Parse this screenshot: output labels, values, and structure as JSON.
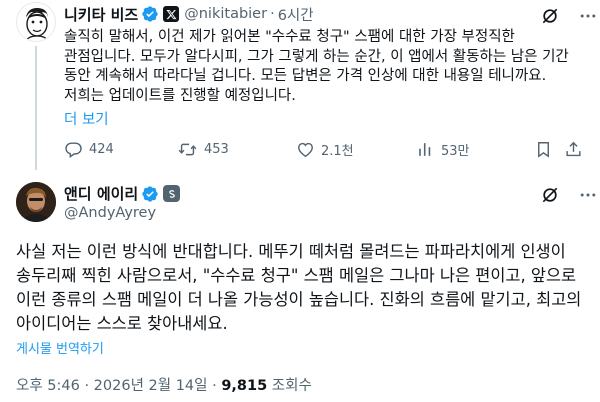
{
  "parent_tweet": {
    "author_name": "니키타 비즈",
    "handle": "@nikitabier",
    "separator": "·",
    "time": "6시간",
    "body": "솔직히 말해서, 이건 제가 읽어본 \"수수료 청구\" 스팸에 대한 가장 부정직한 관점입니다. 모두가 알다시피, 그가 그렇게 하는 순간, 이 앱에서 활동하는 남은 기간 동안 계속해서 따라다닐 겁니다. 모든 답변은 가격 인상에 대한 내용일 테니까요. 저희는 업데이트를 진행할 예정입니다.",
    "show_more": "더 보기",
    "actions": {
      "replies": "424",
      "reposts": "453",
      "likes": "2.1천",
      "views": "53만"
    }
  },
  "main_tweet": {
    "author_name": "앤디 에이리",
    "handle": "@AndyAyrey",
    "body": "사실 저는 이런 방식에 반대합니다. 메뚜기 떼처럼 몰려드는 파파라치에게 인생이 송두리째 찍힌 사람으로서, \"수수료 청구\" 스팸 메일은 그나마 나은 편이고, 앞으로 이런 종류의 스팸 메일이 더 나올 가능성이 높습니다. 진화의 흐름에 맡기고, 최고의 아이디어는 스스로 찾아내세요.",
    "translate": "게시물 번역하기",
    "timestamp": "오후 5:46 · 2026년 2월 14일 · ",
    "views_count": "9,815",
    "views_label": " 조회수"
  },
  "colors": {
    "text_primary": "#0f1419",
    "text_secondary": "#536471",
    "link_blue": "#1d9bf0",
    "verified_blue": "#1d9bf0",
    "thread_line": "#cfd9de"
  },
  "icons": {
    "verified": "verified-badge-icon",
    "x_logo": "x-logo-icon",
    "subscription": "subscription-badge-icon",
    "grok": "grok-icon",
    "more": "more-icon",
    "reply": "reply-icon",
    "repost": "repost-icon",
    "like": "like-icon",
    "views": "views-icon",
    "bookmark": "bookmark-icon",
    "share": "share-icon"
  }
}
